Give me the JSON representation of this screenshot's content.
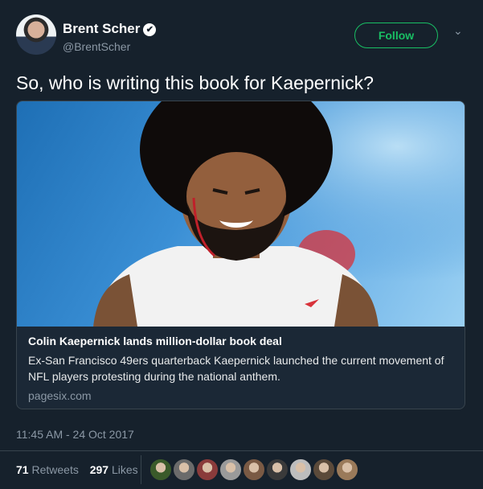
{
  "author": {
    "display_name": "Brent Scher",
    "handle": "@BrentScher",
    "verified_icon": "✔"
  },
  "follow_label": "Follow",
  "caret_glyph": "⌄",
  "tweet_text": "So, who is writing this book for Kaepernick?",
  "card": {
    "title": "Colin Kaepernick lands million-dollar book deal",
    "description": "Ex-San Francisco 49ers quarterback Kaepernick launched the current movement of NFL players protesting during the national anthem.",
    "domain": "pagesix.com"
  },
  "timestamp": "11:45 AM - 24 Oct 2017",
  "stats": {
    "retweets_count": "71",
    "retweets_label": "Retweets",
    "likes_count": "297",
    "likes_label": "Likes"
  },
  "colors": {
    "background": "#16212c",
    "follow_green": "#19bf64",
    "muted_text": "#8b98a5"
  },
  "liker_colors": [
    "#3a5a2a",
    "#6b6b6b",
    "#8a3b3b",
    "#9a9a9a",
    "#7a5a44",
    "#3a3a3a",
    "#bdbdbd",
    "#5b4a3a",
    "#9a7a5a"
  ]
}
